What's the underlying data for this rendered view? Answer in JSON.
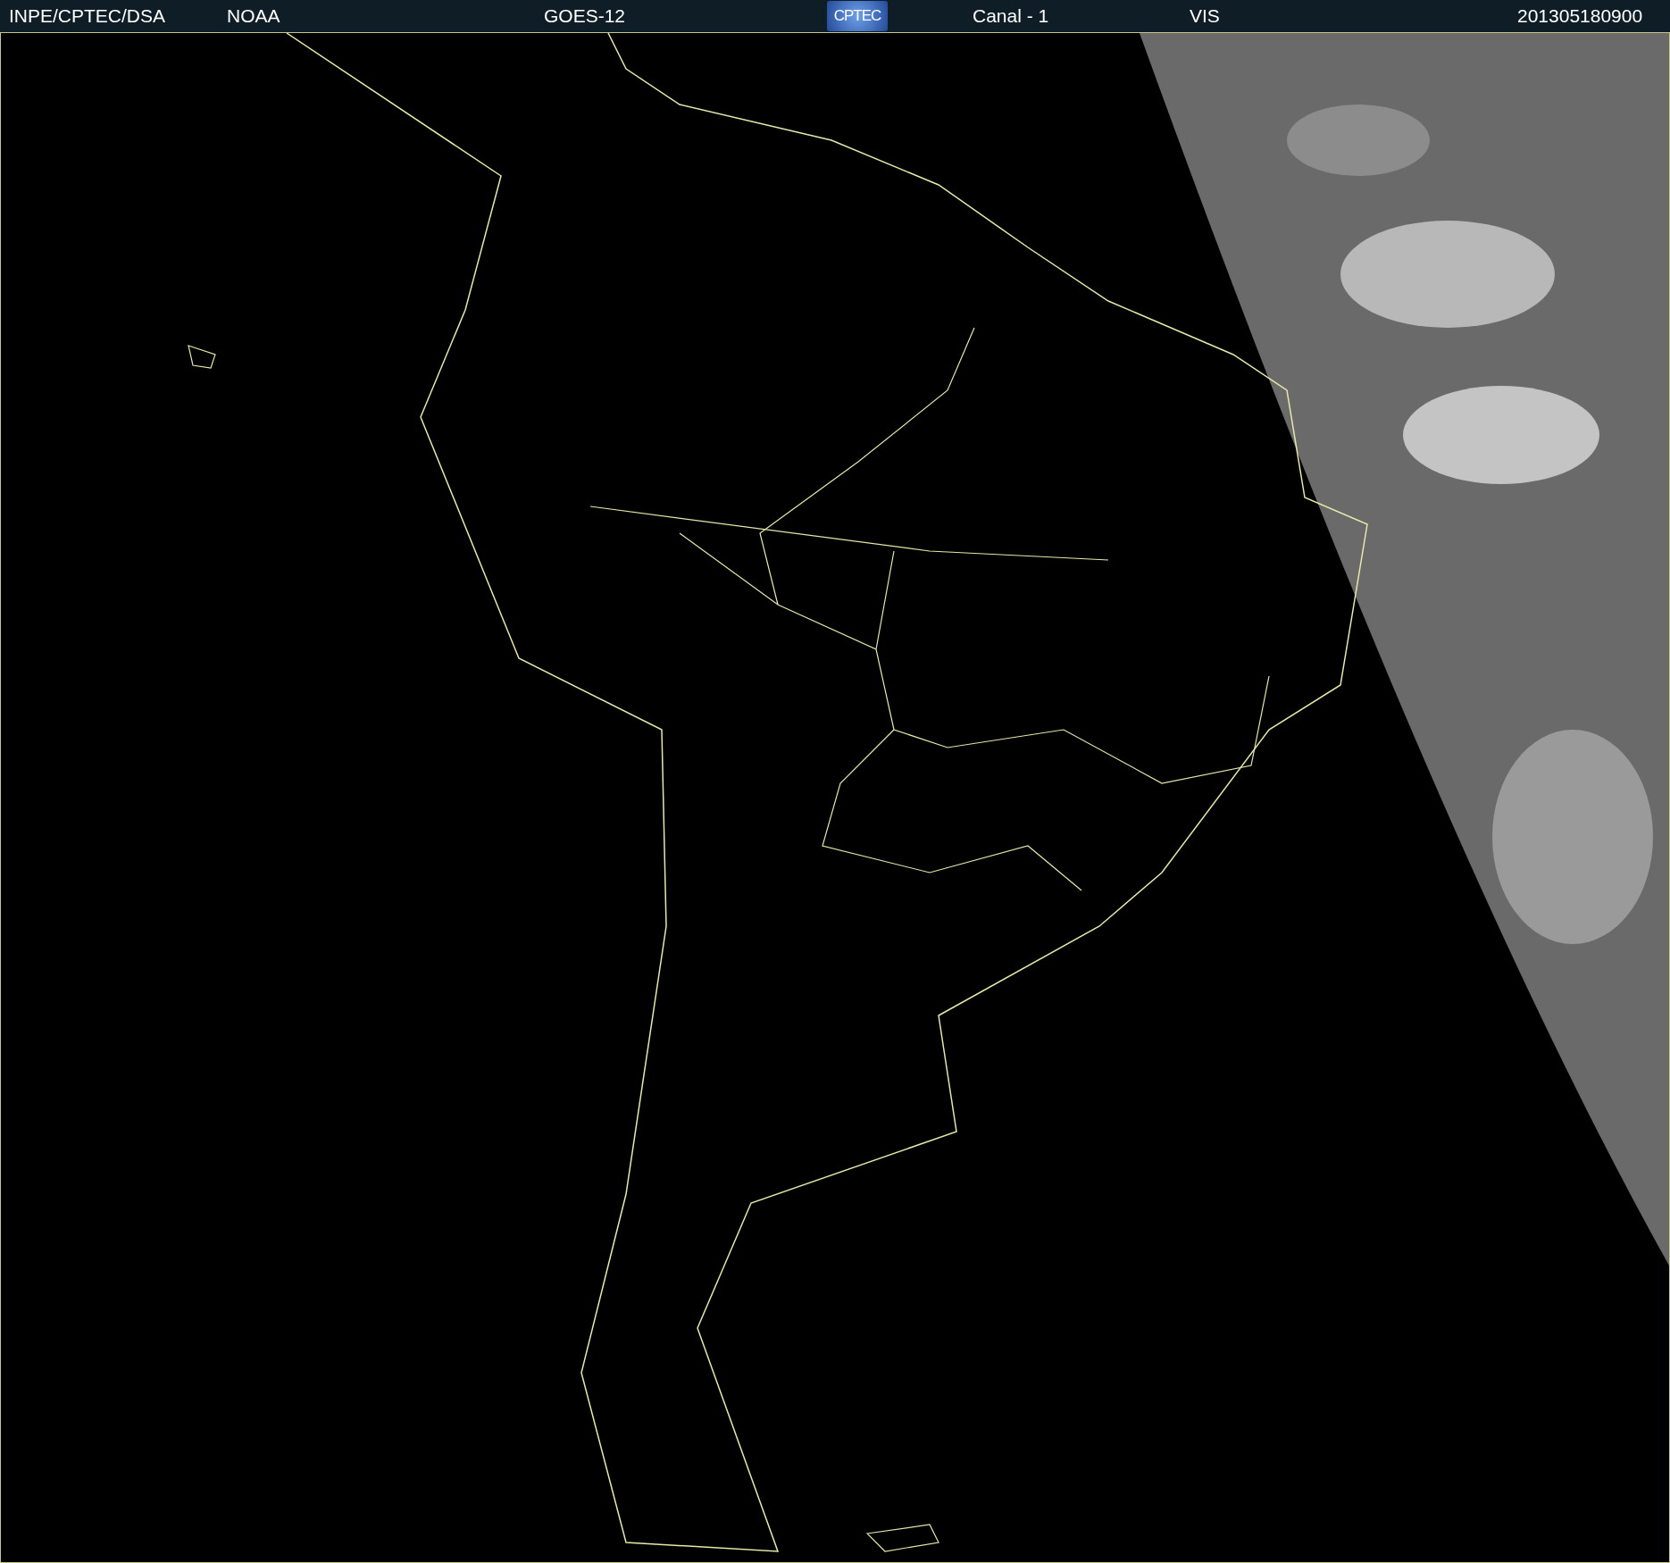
{
  "header": {
    "source": "INPE/CPTEC/DSA",
    "agency": "NOAA",
    "satellite": "GOES-12",
    "logo": "CPTEC",
    "channel": "Canal - 1",
    "band": "VIS",
    "timestamp": "201305180900"
  }
}
